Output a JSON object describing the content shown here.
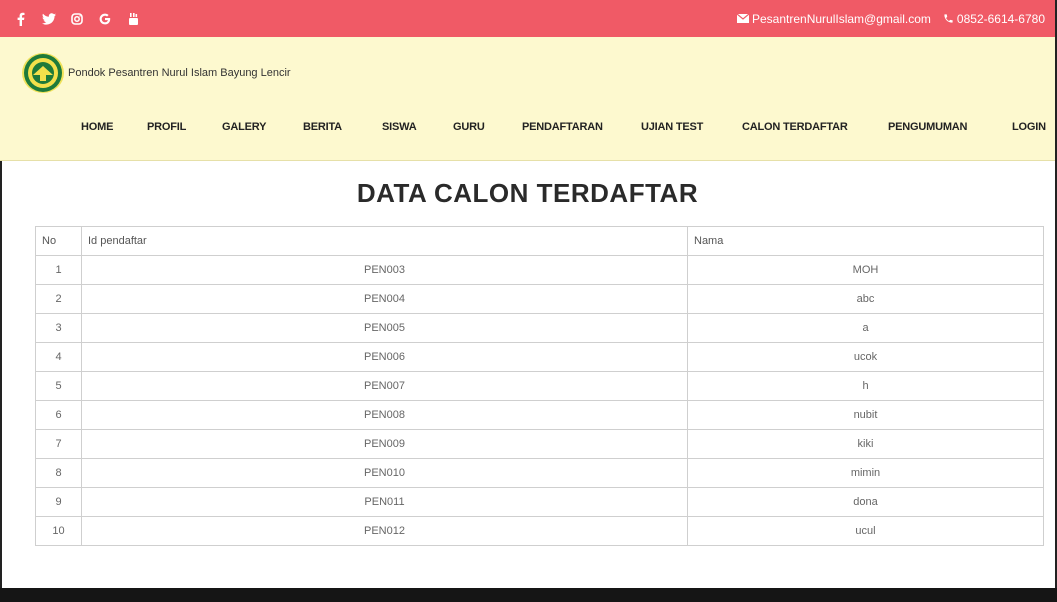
{
  "topbar": {
    "social_icons": [
      "facebook-icon",
      "twitter-icon",
      "instagram-icon",
      "google-icon",
      "youtube-icon"
    ],
    "email": "PesantrenNurulIslam@gmail.com",
    "phone": "0852-6614-6780",
    "bg_color": "#f05a66"
  },
  "header": {
    "site_name": "Pondok Pesantren Nurul Islam Bayung Lencir",
    "bg_color": "#fdf9cf"
  },
  "nav": {
    "items": [
      {
        "label": "HOME"
      },
      {
        "label": "PROFIL"
      },
      {
        "label": "GALERY"
      },
      {
        "label": "BERITA"
      },
      {
        "label": "SISWA"
      },
      {
        "label": "GURU"
      },
      {
        "label": "PENDAFTARAN"
      },
      {
        "label": "UJIAN TEST"
      },
      {
        "label": "CALON TERDAFTAR"
      },
      {
        "label": "PENGUMUMAN"
      },
      {
        "label": "LOGIN"
      }
    ]
  },
  "main": {
    "title": "DATA CALON TERDAFTAR",
    "table": {
      "headers": [
        "No",
        "Id pendaftar",
        "Nama"
      ],
      "rows": [
        {
          "no": "1",
          "id": "PEN003",
          "nama": "MOH"
        },
        {
          "no": "2",
          "id": "PEN004",
          "nama": "abc"
        },
        {
          "no": "3",
          "id": "PEN005",
          "nama": "a"
        },
        {
          "no": "4",
          "id": "PEN006",
          "nama": "ucok"
        },
        {
          "no": "5",
          "id": "PEN007",
          "nama": "h"
        },
        {
          "no": "6",
          "id": "PEN008",
          "nama": "nubit"
        },
        {
          "no": "7",
          "id": "PEN009",
          "nama": "kiki"
        },
        {
          "no": "8",
          "id": "PEN010",
          "nama": "mimin"
        },
        {
          "no": "9",
          "id": "PEN011",
          "nama": "dona"
        },
        {
          "no": "10",
          "id": "PEN012",
          "nama": "ucul"
        }
      ]
    }
  }
}
